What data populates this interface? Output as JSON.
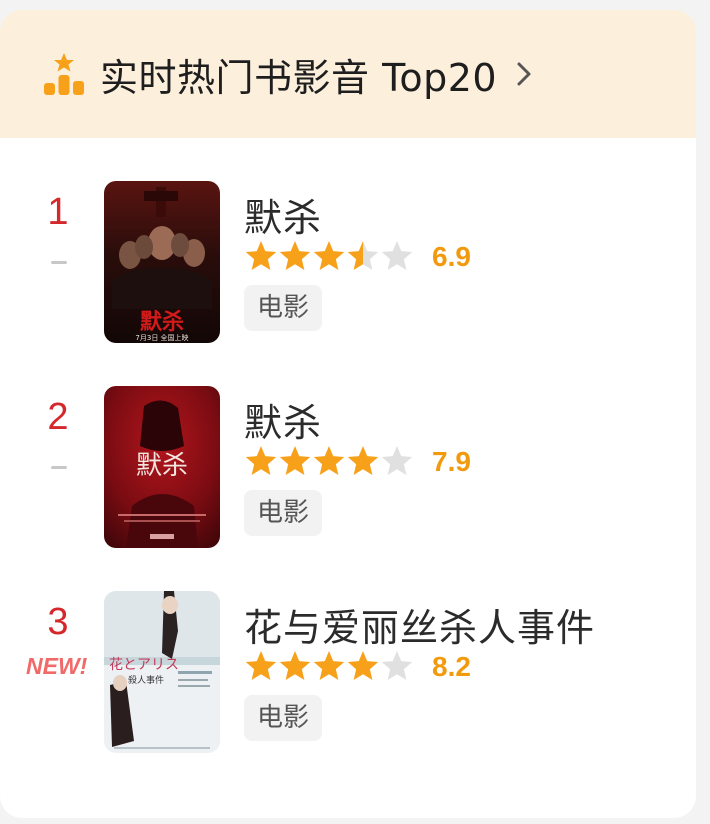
{
  "header": {
    "title": "实时热门书影音 Top20",
    "icon": "ranking-podium-icon",
    "accent_color": "#f7a11b"
  },
  "items": [
    {
      "rank": "1",
      "title": "默杀",
      "rating": 3.5,
      "score": "6.9",
      "tag": "电影",
      "poster_text": "默杀",
      "poster_caption": "7月3日 全国上映"
    },
    {
      "rank": "2",
      "title": "默杀",
      "rating": 4,
      "score": "7.9",
      "tag": "电影",
      "poster_text": "默杀"
    },
    {
      "rank": "3",
      "title": "花与爱丽丝杀人事件",
      "rating": 4,
      "score": "8.2",
      "tag": "电影",
      "badge": "NEW!",
      "poster_text": "花とアリス",
      "poster_subtext": "殺人事件"
    }
  ],
  "colors": {
    "rank": "#d4282d",
    "star_filled": "#f7a11b",
    "star_empty": "#e0e0e0",
    "score": "#f29a0d",
    "new_badge": "#f06a6a",
    "header_bg": "#fcefdc"
  }
}
